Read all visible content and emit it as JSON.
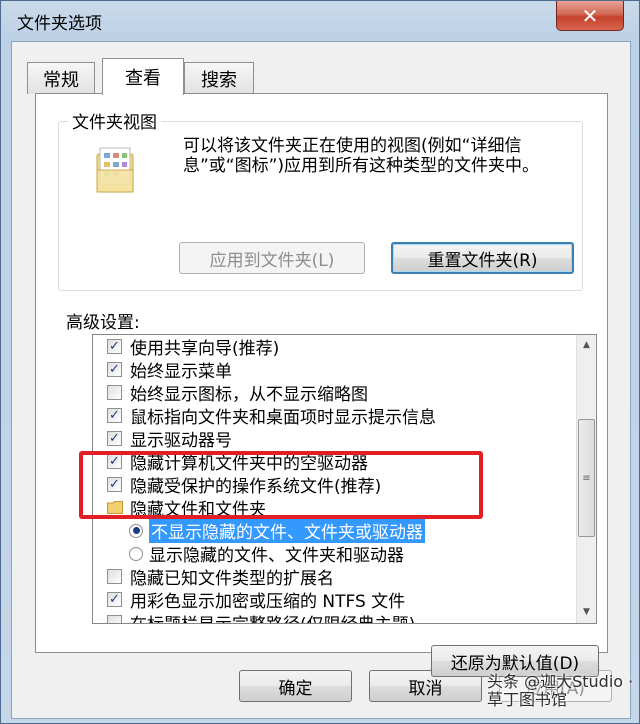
{
  "window": {
    "title": "文件夹选项",
    "close_glyph": "✕"
  },
  "tabs": [
    {
      "label": "常规",
      "active": false
    },
    {
      "label": "查看",
      "active": true
    },
    {
      "label": "搜索",
      "active": false
    }
  ],
  "folder_view": {
    "group_label": "文件夹视图",
    "icon": "folder-settings-icon",
    "description": "可以将该文件夹正在使用的视图(例如“详细信息”或“图标”)应用到所有这种类型的文件夹中。",
    "apply_button": "应用到文件夹(L)",
    "reset_button": "重置文件夹(R)"
  },
  "advanced": {
    "label": "高级设置:",
    "items": [
      {
        "type": "checkbox",
        "checked": true,
        "label": "使用共享向导(推荐)"
      },
      {
        "type": "checkbox",
        "checked": true,
        "label": "始终显示菜单"
      },
      {
        "type": "checkbox",
        "checked": false,
        "label": "始终显示图标，从不显示缩略图"
      },
      {
        "type": "checkbox",
        "checked": true,
        "label": "鼠标指向文件夹和桌面项时显示提示信息"
      },
      {
        "type": "checkbox",
        "checked": true,
        "label": "显示驱动器号"
      },
      {
        "type": "checkbox",
        "checked": true,
        "label": "隐藏计算机文件夹中的空驱动器"
      },
      {
        "type": "checkbox",
        "checked": true,
        "label": "隐藏受保护的操作系统文件(推荐)"
      },
      {
        "type": "folder",
        "label": "隐藏文件和文件夹"
      },
      {
        "type": "radio",
        "checked": true,
        "label": "不显示隐藏的文件、文件夹或驱动器"
      },
      {
        "type": "radio",
        "checked": false,
        "label": "显示隐藏的文件、文件夹和驱动器"
      },
      {
        "type": "checkbox",
        "checked": false,
        "label": "隐藏已知文件类型的扩展名"
      },
      {
        "type": "checkbox",
        "checked": true,
        "label": "用彩色显示加密或压缩的 NTFS 文件"
      },
      {
        "type": "checkbox",
        "checked": false,
        "label": "在标题栏显示完整路径(仅限经典主题)"
      }
    ],
    "scroll_up_glyph": "▲",
    "scroll_down_glyph": "▼",
    "thumb_grip_glyph": "≡"
  },
  "restore_button": "还原为默认值(D)",
  "footer": {
    "ok": "确定",
    "cancel": "取消",
    "apply": "应用(A)"
  },
  "watermark": "头条 @迦大Studio · 草丁图书馆",
  "colors": {
    "highlight": "#e01e23",
    "selection": "#3399ff"
  }
}
